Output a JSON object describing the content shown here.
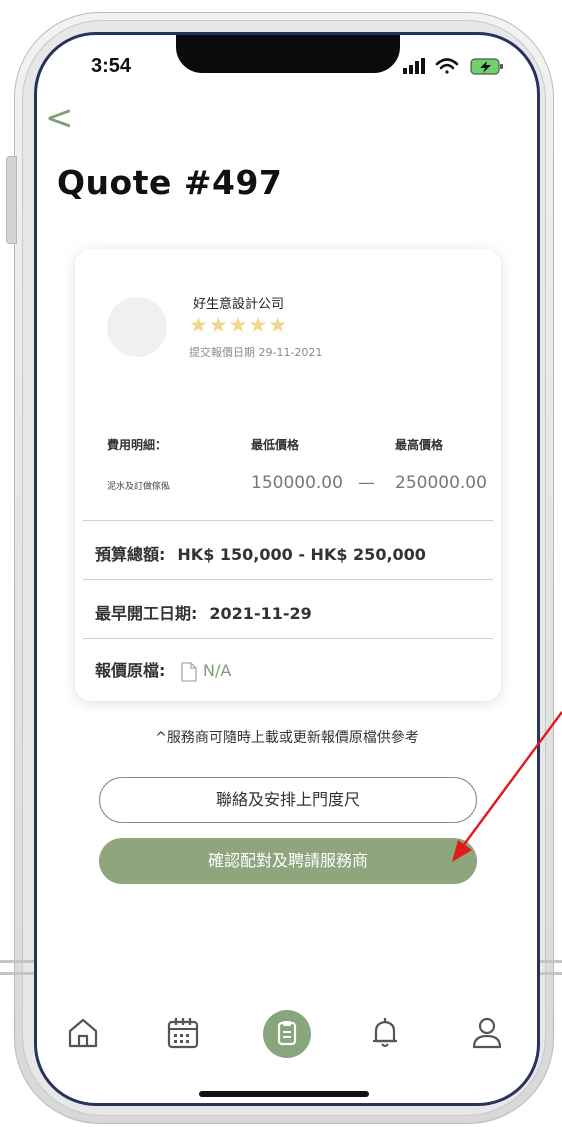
{
  "status_bar": {
    "time": "3:54"
  },
  "header": {
    "title": "Quote #497"
  },
  "card": {
    "company": "好生意設計公司",
    "rating": 4.5,
    "stars": "★★★★★",
    "submit_date": "提交報價日期 29-11-2021",
    "fee_header": "費用明細：",
    "min_header": "最低價格",
    "max_header": "最高價格",
    "item_name": "泥水及訂做傢俬",
    "min_price": "150000.00",
    "separator": "—",
    "max_price": "250000.00",
    "budget_label": "預算總額:",
    "budget_value": "HK$ 150,000 - HK$ 250,000",
    "start_label": "最早開工日期:",
    "start_value": "2021-11-29",
    "file_label": "報價原檔:",
    "file_value": "N/A"
  },
  "note": "^服務商可隨時上載或更新報價原檔供參考",
  "buttons": {
    "contact": "聯絡及安排上門度尺",
    "confirm": "確認配對及聘請服務商"
  },
  "nav": [
    "home-icon",
    "calendar-icon",
    "clipboard-icon",
    "bell-icon",
    "user-icon"
  ],
  "colors": {
    "accent": "#8ea57e",
    "star": "#f3d68c",
    "annotation_arrow": "#e01b1b"
  }
}
